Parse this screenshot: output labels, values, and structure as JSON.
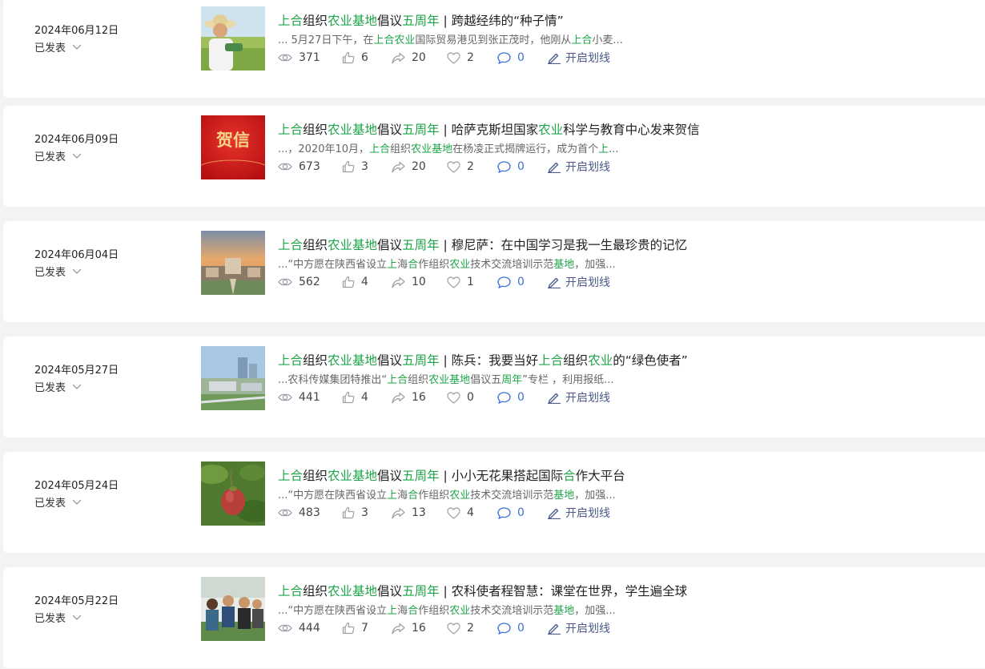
{
  "articles": [
    {
      "date": "2024年06月12日",
      "status": "已发表",
      "title": [
        [
          "上合",
          "hl"
        ],
        [
          "组织",
          ""
        ],
        [
          "农业基地",
          "hl"
        ],
        [
          "倡议",
          ""
        ],
        [
          "五周年",
          "hl"
        ],
        [
          " | 跨越经纬的“种子情”",
          ""
        ]
      ],
      "excerpt": [
        [
          "... 5月27日下午，在",
          ""
        ],
        [
          "上合农业",
          "hl"
        ],
        [
          "国际贸易港见到张正茂时，他刚从",
          ""
        ],
        [
          "上合",
          "hl"
        ],
        [
          "小麦...",
          ""
        ]
      ],
      "views": "371",
      "likes": "6",
      "shares": "20",
      "favorites": "2",
      "comments": "0",
      "mark_label": "开启划线",
      "thumb": "farmer-photo"
    },
    {
      "date": "2024年06月09日",
      "status": "已发表",
      "title": [
        [
          "上合",
          "hl"
        ],
        [
          "组织",
          ""
        ],
        [
          "农业基地",
          "hl"
        ],
        [
          "倡议",
          ""
        ],
        [
          "五周年",
          "hl"
        ],
        [
          " | 哈萨克斯坦国家",
          ""
        ],
        [
          "农业",
          "hl"
        ],
        [
          "科学与教育中心发来贺信",
          ""
        ]
      ],
      "excerpt": [
        [
          "...，2020年10月，",
          ""
        ],
        [
          "上合",
          "hl"
        ],
        [
          "组织",
          ""
        ],
        [
          "农业基地",
          "hl"
        ],
        [
          "在杨凌正式揭牌运行，成为首个",
          ""
        ],
        [
          "上",
          "hl"
        ],
        [
          "...",
          ""
        ]
      ],
      "views": "673",
      "likes": "3",
      "shares": "20",
      "favorites": "2",
      "comments": "0",
      "mark_label": "开启划线",
      "thumb": "congratulation-letter",
      "thumb_text": "贺信"
    },
    {
      "date": "2024年06月04日",
      "status": "已发表",
      "title": [
        [
          "上合",
          "hl"
        ],
        [
          "组织",
          ""
        ],
        [
          "农业基地",
          "hl"
        ],
        [
          "倡议",
          ""
        ],
        [
          "五周年",
          "hl"
        ],
        [
          " | 穆尼萨：在中国学习是我一生最珍贵的记忆",
          ""
        ]
      ],
      "excerpt": [
        [
          "...“中方愿在陕西省设立",
          ""
        ],
        [
          "上",
          "hl"
        ],
        [
          "海",
          ""
        ],
        [
          "合",
          "hl"
        ],
        [
          "作组织",
          ""
        ],
        [
          "农业",
          "hl"
        ],
        [
          "技术交流培训示范",
          ""
        ],
        [
          "基地",
          "hl"
        ],
        [
          "，加强...",
          ""
        ]
      ],
      "views": "562",
      "likes": "4",
      "shares": "10",
      "favorites": "1",
      "comments": "0",
      "mark_label": "开启划线",
      "thumb": "campus-aerial-photo"
    },
    {
      "date": "2024年05月27日",
      "status": "已发表",
      "title": [
        [
          "上合",
          "hl"
        ],
        [
          "组织",
          ""
        ],
        [
          "农业基地",
          "hl"
        ],
        [
          "倡议",
          ""
        ],
        [
          "五周年",
          "hl"
        ],
        [
          " | 陈兵：我要当好",
          ""
        ],
        [
          "上合",
          "hl"
        ],
        [
          "组织",
          ""
        ],
        [
          "农业",
          "hl"
        ],
        [
          "的“绿色使者”",
          ""
        ]
      ],
      "excerpt": [
        [
          "...农科传媒集团特推出“",
          ""
        ],
        [
          "上合",
          "hl"
        ],
        [
          "组织",
          ""
        ],
        [
          "农业基地",
          "hl"
        ],
        [
          "倡议五",
          ""
        ],
        [
          "周年",
          "hl"
        ],
        [
          "”专栏 ，利用报纸...",
          ""
        ]
      ],
      "views": "441",
      "likes": "4",
      "shares": "16",
      "favorites": "0",
      "comments": "0",
      "mark_label": "开启划线",
      "thumb": "city-aerial-photo"
    },
    {
      "date": "2024年05月24日",
      "status": "已发表",
      "title": [
        [
          "上合",
          "hl"
        ],
        [
          "组织",
          ""
        ],
        [
          "农业基地",
          "hl"
        ],
        [
          "倡议",
          ""
        ],
        [
          "五周年",
          "hl"
        ],
        [
          " | 小小无花果搭起国际",
          ""
        ],
        [
          "合",
          "hl"
        ],
        [
          "作大平台",
          ""
        ]
      ],
      "excerpt": [
        [
          "...“中方愿在陕西省设立",
          ""
        ],
        [
          "上",
          "hl"
        ],
        [
          "海",
          ""
        ],
        [
          "合",
          "hl"
        ],
        [
          "作组织",
          ""
        ],
        [
          "农业",
          "hl"
        ],
        [
          "技术交流培训示范",
          ""
        ],
        [
          "基地",
          "hl"
        ],
        [
          "，加强...",
          ""
        ]
      ],
      "views": "483",
      "likes": "3",
      "shares": "13",
      "favorites": "4",
      "comments": "0",
      "mark_label": "开启划线",
      "thumb": "fig-fruit-photo"
    },
    {
      "date": "2024年05月22日",
      "status": "已发表",
      "title": [
        [
          "上合",
          "hl"
        ],
        [
          "组织",
          ""
        ],
        [
          "农业基地",
          "hl"
        ],
        [
          "倡议",
          ""
        ],
        [
          "五周年",
          "hl"
        ],
        [
          " | 农科使者程智慧：课堂在世界，学生遍全球",
          ""
        ]
      ],
      "excerpt": [
        [
          "...“中方愿在陕西省设立",
          ""
        ],
        [
          "上",
          "hl"
        ],
        [
          "海",
          ""
        ],
        [
          "合",
          "hl"
        ],
        [
          "作组织",
          ""
        ],
        [
          "农业",
          "hl"
        ],
        [
          "技术交流培训示范",
          ""
        ],
        [
          "基地",
          "hl"
        ],
        [
          "，加强...",
          ""
        ]
      ],
      "views": "444",
      "likes": "7",
      "shares": "16",
      "favorites": "2",
      "comments": "0",
      "mark_label": "开启划线",
      "thumb": "group-visit-photo"
    }
  ],
  "colors": {
    "highlight": "#1fa64a",
    "comment_count": "#3b6fd8",
    "mark": "#4a5a8a",
    "icon": "#9aa0a8"
  }
}
